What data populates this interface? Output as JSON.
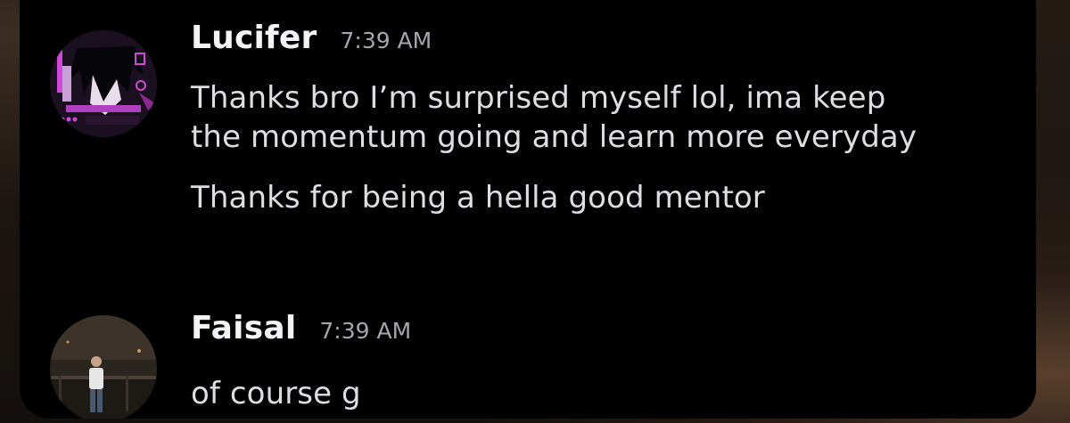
{
  "messages": [
    {
      "author": "Lucifer",
      "timestamp": "7:39 AM",
      "avatar_icon": "anime-avatar-icon",
      "lines": [
        "Thanks bro I’m surprised myself lol, ima keep",
        "the momentum going and learn more everyday",
        "Thanks for being a hella good mentor"
      ]
    },
    {
      "author": "Faisal",
      "timestamp": "7:39 AM",
      "avatar_icon": "photo-avatar-icon",
      "lines": [
        "of course g"
      ]
    }
  ],
  "colors": {
    "panel_background": "#000000",
    "username": "#f2f3f5",
    "timestamp": "#a3a6ad",
    "message_text": "#dcdee1",
    "avatar_accent": "#c040c8"
  }
}
